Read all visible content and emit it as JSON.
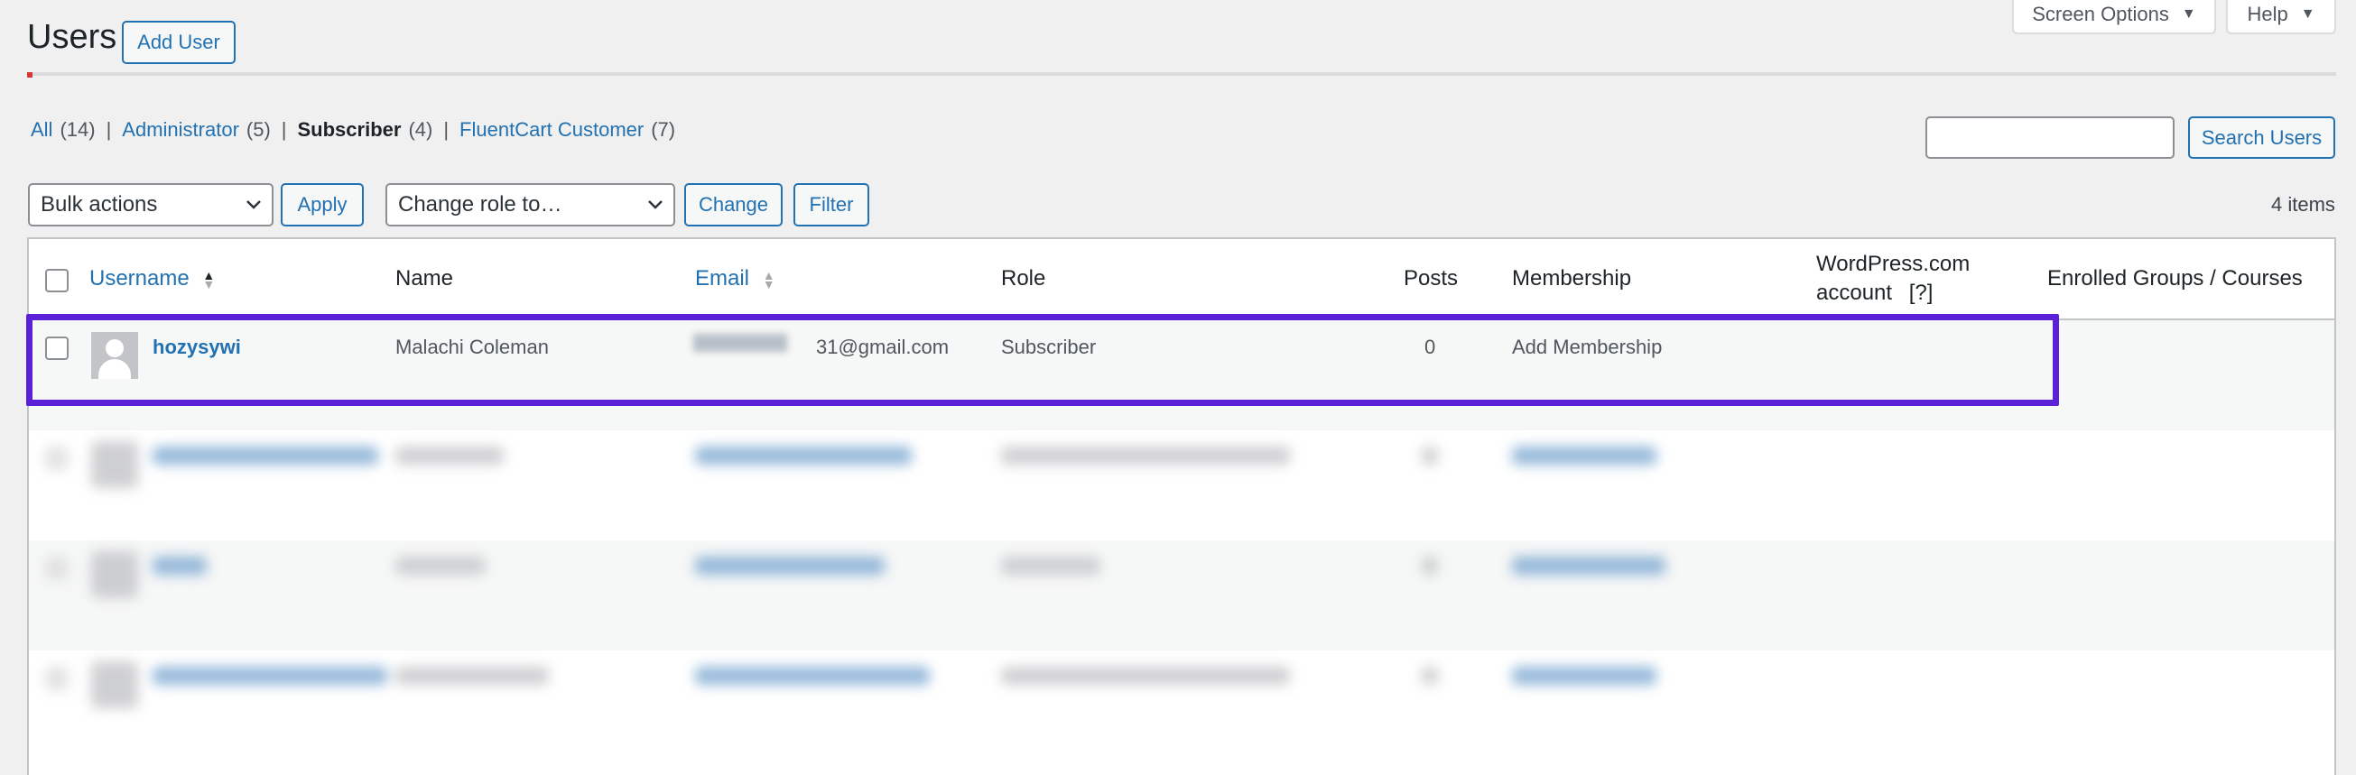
{
  "header": {
    "title": "Users",
    "add_user_label": "Add User",
    "screen_options_label": "Screen Options",
    "help_label": "Help"
  },
  "filters": [
    {
      "label": "All",
      "count": "(14)"
    },
    {
      "label": "Administrator",
      "count": "(5)"
    },
    {
      "label": "Subscriber",
      "count": "(4)"
    },
    {
      "label": "FluentCart Customer",
      "count": "(7)"
    }
  ],
  "search": {
    "value": "",
    "button_label": "Search Users"
  },
  "tablenav": {
    "bulk_actions": "Bulk actions",
    "apply_label": "Apply",
    "change_role": "Change role to…",
    "change_label": "Change",
    "filter_label": "Filter",
    "items_count": "4 items"
  },
  "table": {
    "columns": {
      "username": "Username",
      "name": "Name",
      "email": "Email",
      "role": "Role",
      "posts": "Posts",
      "membership": "Membership",
      "wpcom_line1": "WordPress.com",
      "wpcom_line2": "account",
      "wpcom_help": "[?]",
      "enrolled": "Enrolled Groups / Courses"
    },
    "rows": [
      {
        "username": "hozysywi",
        "name": "Malachi Coleman",
        "email": "31@gmail.com",
        "role": "Subscriber",
        "posts": "0",
        "membership": "Add Membership"
      }
    ]
  },
  "colors": {
    "accent": "#2271b1",
    "highlight": "#5b21d6",
    "background": "#f0f0f1"
  }
}
